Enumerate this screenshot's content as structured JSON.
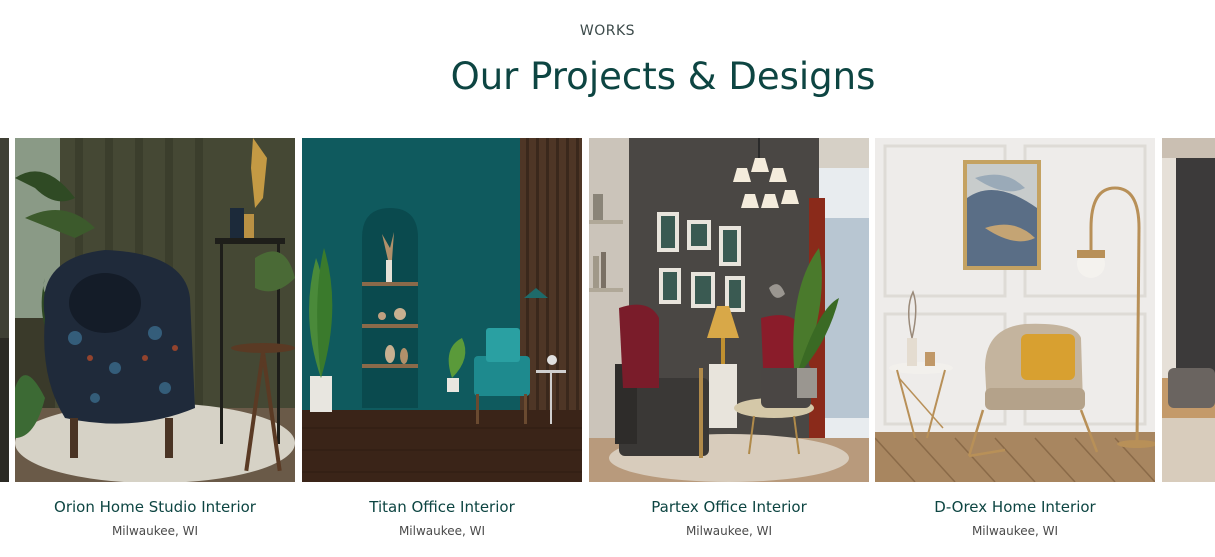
{
  "section": {
    "eyebrow": "WORKS",
    "heading": "Our Projects & Designs"
  },
  "projects": [
    {
      "title": "Orion Home Studio Interior",
      "location": "Milwaukee, WI"
    },
    {
      "title": "Titan Office Interior",
      "location": "Milwaukee, WI"
    },
    {
      "title": "Partex Office Interior",
      "location": "Milwaukee, WI"
    },
    {
      "title": "D-Orex Home Interior",
      "location": "Milwaukee, WI"
    }
  ],
  "colors": {
    "heading": "#0d4542",
    "eyebrow": "#3c4a4a",
    "location": "#4a4a4a"
  }
}
